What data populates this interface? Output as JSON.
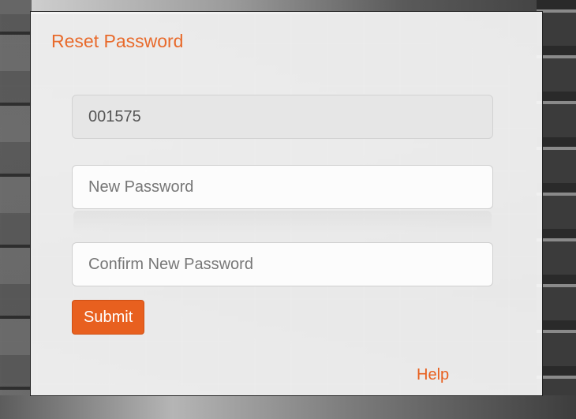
{
  "reset_password": {
    "title": "Reset Password",
    "user_id_value": "001575",
    "new_password_placeholder": "New Password",
    "confirm_password_placeholder": "Confirm New Password",
    "submit_label": "Submit",
    "help_label": "Help"
  },
  "colors": {
    "accent": "#e8601f",
    "title": "#e86a2b"
  }
}
